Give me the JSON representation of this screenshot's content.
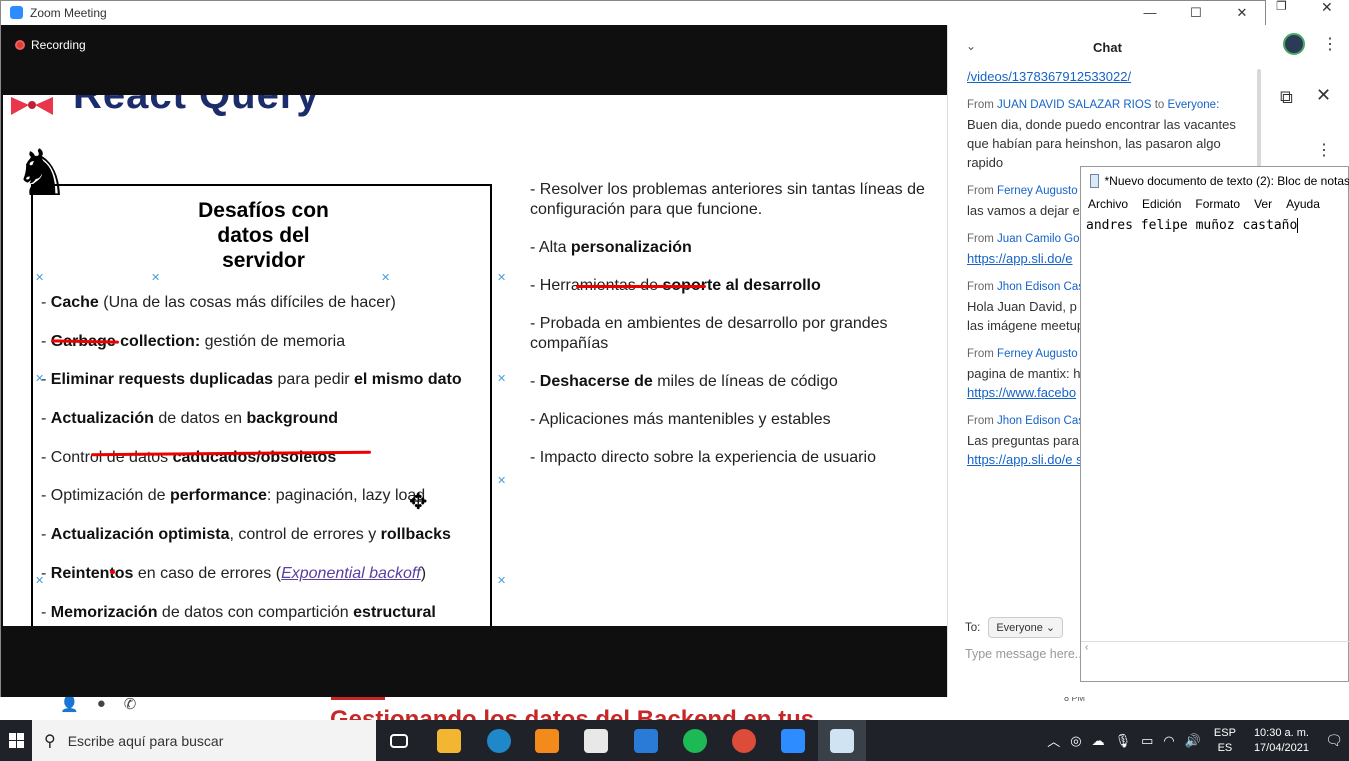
{
  "zoom": {
    "title": "Zoom Meeting",
    "recording_label": "Recording",
    "window_buttons": [
      "—",
      "☐",
      "✕"
    ]
  },
  "slide": {
    "header": "React Query",
    "box_title": [
      "Desafíos con",
      "datos del",
      "servidor"
    ],
    "box_items": [
      {
        "parts": [
          [
            "- ",
            false
          ],
          [
            "Cache",
            true
          ],
          [
            " (Una de las cosas más difíciles de hacer)",
            false
          ]
        ]
      },
      {
        "parts": [
          [
            "- ",
            false
          ],
          [
            "Garbage collection:",
            true
          ],
          [
            " gestión de memoria",
            false
          ]
        ]
      },
      {
        "parts": [
          [
            "- ",
            false
          ],
          [
            "Eliminar requests duplicadas",
            true
          ],
          [
            " para pedir ",
            false
          ],
          [
            "el mismo dato",
            true
          ]
        ]
      },
      {
        "parts": [
          [
            "- ",
            false
          ],
          [
            "Actualización",
            true
          ],
          [
            " de datos en ",
            false
          ],
          [
            "background",
            true
          ]
        ]
      },
      {
        "parts": [
          [
            "- Control de datos ",
            false
          ],
          [
            "caducados/obsoletos",
            true
          ]
        ]
      },
      {
        "parts": [
          [
            "- Optimización de ",
            false
          ],
          [
            "performance",
            true
          ],
          [
            ": paginación, lazy load",
            false
          ]
        ]
      },
      {
        "parts": [
          [
            "- ",
            false
          ],
          [
            "Actualización optimista",
            true
          ],
          [
            ", control de errores y ",
            false
          ],
          [
            "rollbacks",
            true
          ]
        ]
      },
      {
        "parts": [
          [
            "- ",
            false
          ],
          [
            "Reintentos",
            true
          ],
          [
            " en caso de errores (",
            false
          ],
          [
            "Exponential backoff",
            "link"
          ],
          [
            ")",
            false
          ]
        ]
      },
      {
        "parts": [
          [
            "- ",
            false
          ],
          [
            "Memorización",
            true
          ],
          [
            " de datos con compartición ",
            false
          ],
          [
            "estructural",
            true
          ]
        ]
      }
    ],
    "right_items": [
      {
        "parts": [
          [
            "- Resolver los problemas anteriores sin tantas líneas de configuración para que funcione.",
            false
          ]
        ]
      },
      {
        "parts": [
          [
            "- Alta ",
            false
          ],
          [
            "personalización",
            true
          ]
        ]
      },
      {
        "parts": [
          [
            "- Herramientas de ",
            false
          ],
          [
            "soporte al desarrollo",
            true
          ]
        ]
      },
      {
        "parts": [
          [
            "- Probada en ambientes de desarrollo por grandes compañías",
            false
          ]
        ]
      },
      {
        "parts": [
          [
            "- ",
            false
          ],
          [
            "Deshacerse de",
            true
          ],
          [
            " miles de líneas de código",
            false
          ]
        ]
      },
      {
        "parts": [
          [
            "- Aplicaciones más mantenibles y estables",
            false
          ]
        ]
      },
      {
        "parts": [
          [
            "- Impacto directo sobre la experiencia de usuario",
            false
          ]
        ]
      }
    ]
  },
  "chat": {
    "title": "Chat",
    "top_link": "/videos/1378367912533022/",
    "messages": [
      {
        "from_label": "From",
        "sender": "JUAN DAVID SALAZAR RIOS",
        "to_label": "to",
        "recipient": "Everyone:",
        "text": "Buen dia, donde puedo encontrar las vacantes que habían para heinshon, las pasaron algo rapido",
        "link": ""
      },
      {
        "from_label": "From",
        "sender": "Ferney Augusto",
        "to_label": "",
        "recipient": "",
        "text": "las vamos a dejar e allí las encontrara",
        "link": ""
      },
      {
        "from_label": "From",
        "sender": "Juan Camilo Go",
        "to_label": "",
        "recipient": "",
        "text": "",
        "link": "https://app.sli.do/e"
      },
      {
        "from_label": "From",
        "sender": "Jhon Edison Cas",
        "to_label": "",
        "recipient": "",
        "text": "Hola Juan David, p vperez@heinsohn.c enviaré las imágene meetup",
        "link": ""
      },
      {
        "from_label": "From",
        "sender": "Ferney Augusto",
        "to_label": "",
        "recipient": "",
        "text": "pagina de mantix: h fanpage:",
        "link": "https://www.facebo"
      },
      {
        "from_label": "From",
        "sender": "Jhon Edison Cas",
        "to_label": "",
        "recipient": "",
        "text": "Las preguntas para en el siguiente enla",
        "link": "https://app.sli.do/e stions"
      }
    ],
    "to_label": "To:",
    "to_value": "Everyone",
    "input_placeholder": "Type message here..."
  },
  "notepad": {
    "title": "*Nuevo documento de texto (2): Bloc de notas",
    "menu": [
      "Archivo",
      "Edición",
      "Formato",
      "Ver",
      "Ayuda"
    ],
    "content": "andres felipe muñoz castaño"
  },
  "background": {
    "bottom_header": "Gestionando los datos del Backend en tus",
    "small_time": "8 PM"
  },
  "taskbar": {
    "search_placeholder": "Escribe aquí para buscar",
    "lang_top": "ESP",
    "lang_bottom": "ES",
    "time": "10:30 a. m.",
    "date": "17/04/2021",
    "apps": [
      {
        "name": "task-view",
        "color": "#1f2329"
      },
      {
        "name": "file-explorer",
        "color": "#f2b632"
      },
      {
        "name": "edge",
        "color": "#1e88c8"
      },
      {
        "name": "sublime-text",
        "color": "#f28a1c"
      },
      {
        "name": "store",
        "color": "#e8e8e8"
      },
      {
        "name": "mail",
        "color": "#2a7ad8"
      },
      {
        "name": "spotify",
        "color": "#1db954"
      },
      {
        "name": "chrome",
        "color": "#dd4b39"
      },
      {
        "name": "zoom",
        "color": "#2d8cff"
      },
      {
        "name": "notepad",
        "color": "#cfe3f3"
      }
    ]
  },
  "colors": {
    "zoom_blue": "#2d8cff",
    "chat_link": "#1463c9",
    "annotation_red": "#e00000",
    "slide_title_navy": "#1b2c6b"
  }
}
